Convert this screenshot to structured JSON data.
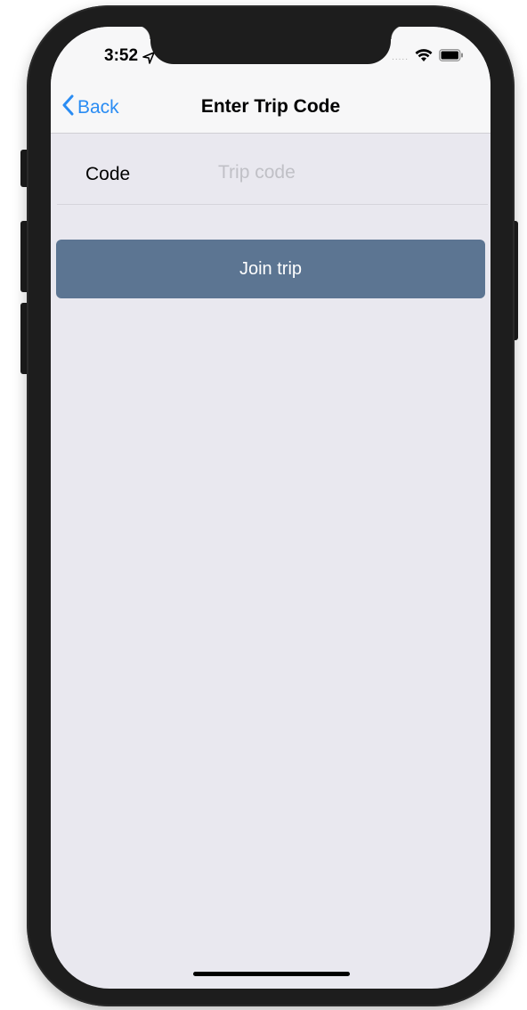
{
  "status_bar": {
    "time": "3:52",
    "icons": [
      "location-arrow-icon",
      "signal-dots-icon",
      "wifi-icon",
      "battery-icon"
    ],
    "signal_dots": "....."
  },
  "nav": {
    "back_label": "Back",
    "title": "Enter Trip Code"
  },
  "form": {
    "code_label": "Code",
    "code_value": "",
    "code_placeholder": "Trip code"
  },
  "actions": {
    "join_label": "Join trip"
  },
  "colors": {
    "accent": "#2a8cf3",
    "button_bg": "#5c7592",
    "background": "#e9e8ef",
    "nav_bg": "#f7f7f8"
  }
}
